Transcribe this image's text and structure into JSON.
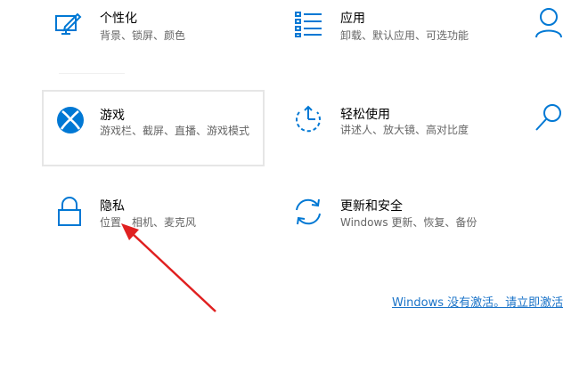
{
  "colors": {
    "accent": "#0078d4",
    "annotation": "#e02020",
    "link": "#1a73c8",
    "description": "#666666"
  },
  "tiles": [
    {
      "title": "个性化",
      "desc": "背景、锁屏、颜色",
      "icon": "personalization-icon"
    },
    {
      "title": "应用",
      "desc": "卸载、默认应用、可选功能",
      "icon": "apps-icon"
    },
    {
      "title": "游戏",
      "desc": "游戏栏、截屏、直播、游戏模式",
      "icon": "xbox-icon"
    },
    {
      "title": "轻松使用",
      "desc": "讲述人、放大镜、高对比度",
      "icon": "ease-of-access-icon"
    },
    {
      "title": "隐私",
      "desc": "位置、相机、麦克风",
      "icon": "lock-icon"
    },
    {
      "title": "更新和安全",
      "desc": "Windows 更新、恢复、备份",
      "icon": "update-sync-icon"
    }
  ],
  "activation": {
    "text": "Windows 没有激活。请立即激活"
  },
  "annotation": {
    "icon": "red-arrow-annotation"
  }
}
